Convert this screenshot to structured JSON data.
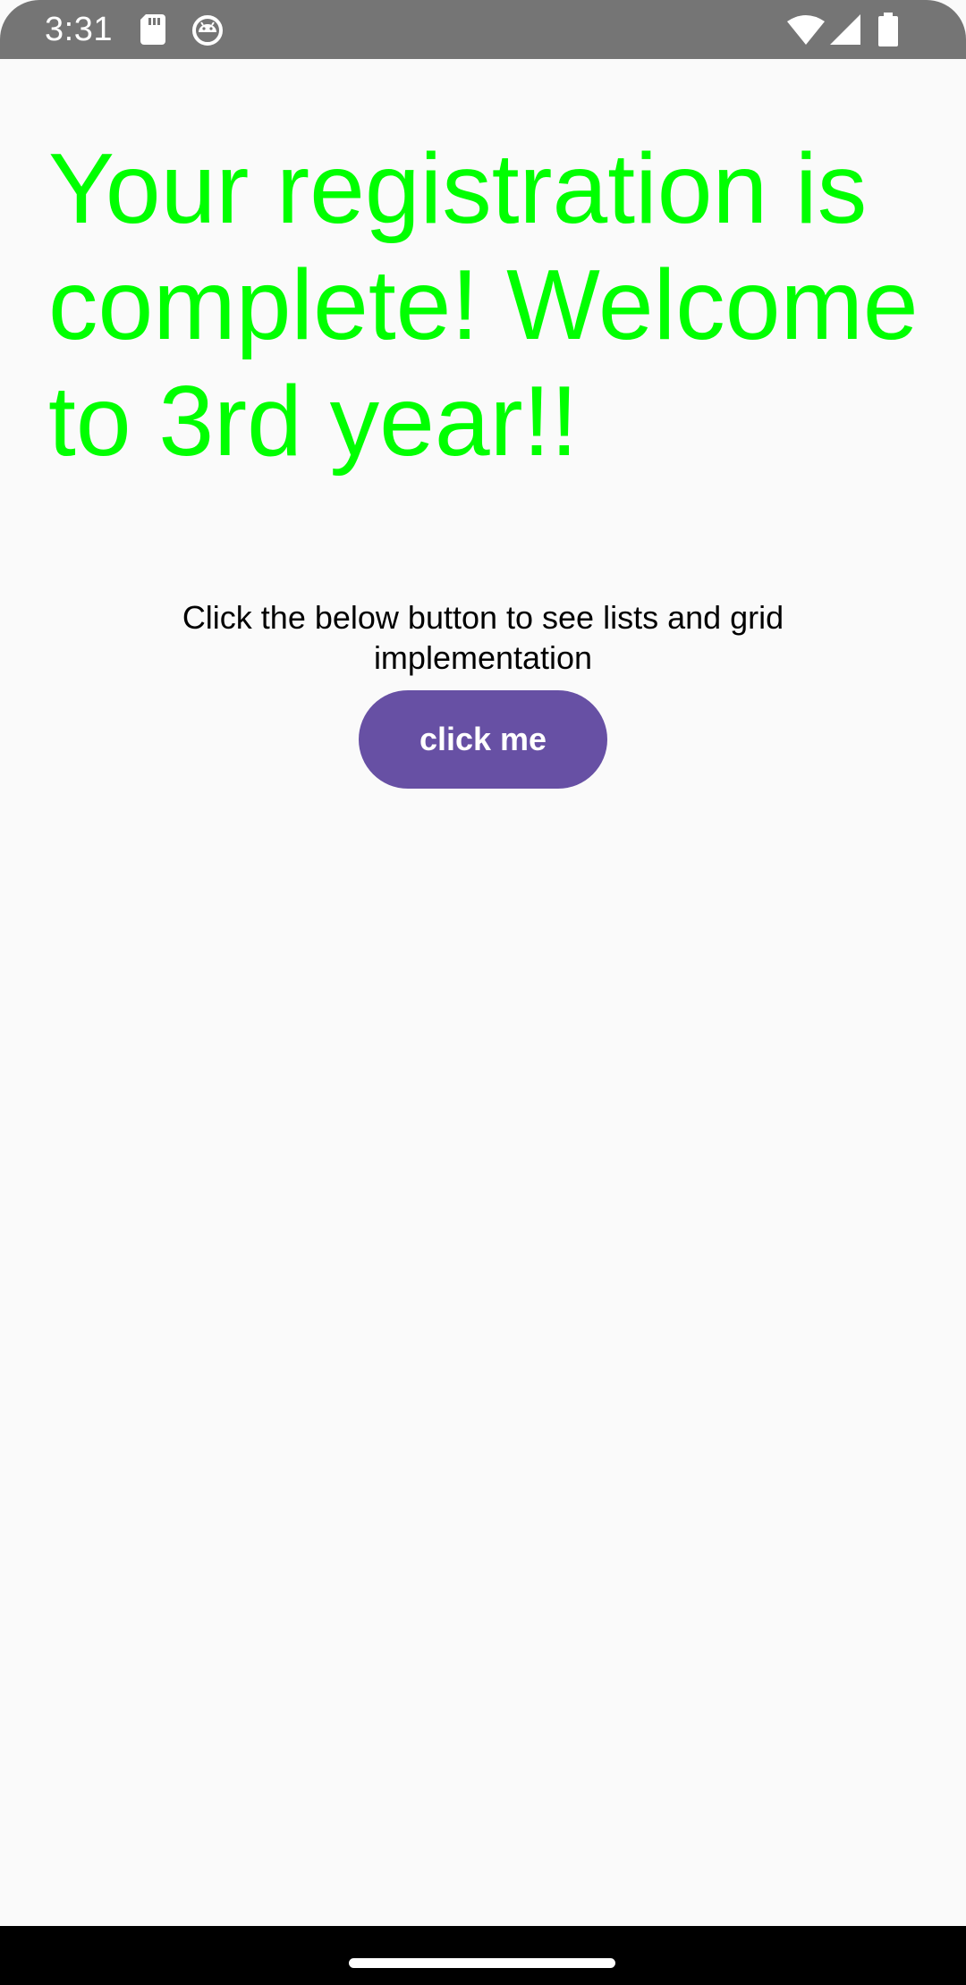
{
  "status_bar": {
    "time": "3:31",
    "background_color": "#757575",
    "icons": [
      "sd-card-icon",
      "android-debug-icon",
      "wifi-icon",
      "cell-signal-icon",
      "battery-icon"
    ]
  },
  "main": {
    "headline": "Your registration is complete! Welcome to 3rd year!!",
    "headline_color": "#00ff00",
    "instruction": "Click the below button to see lists and grid implementation",
    "button_label": "click me",
    "button_color": "#6750a4"
  },
  "nav_bar": {
    "background_color": "#000000",
    "home_handle": "home-gesture-handle"
  }
}
